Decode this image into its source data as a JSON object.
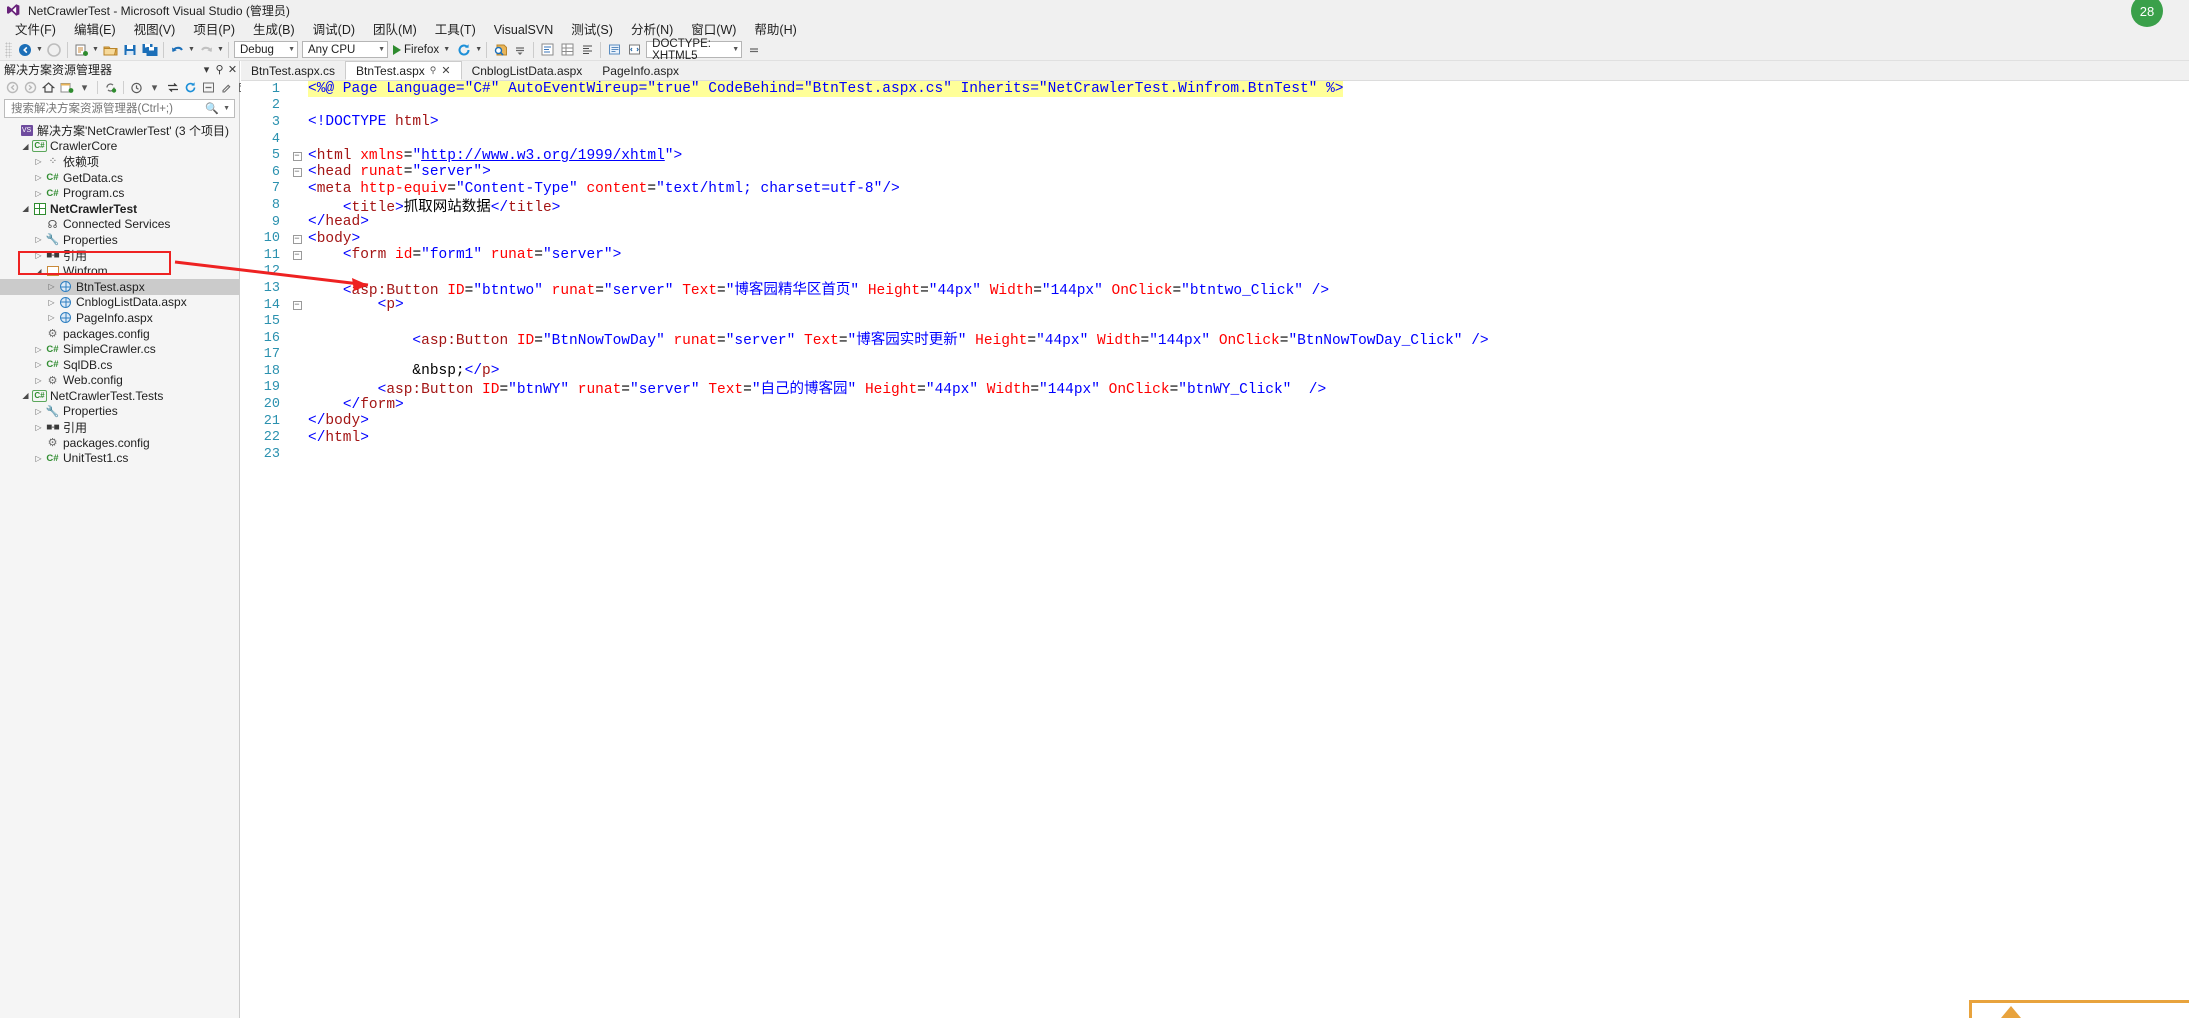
{
  "window": {
    "title": "NetCrawlerTest - Microsoft Visual Studio (管理员)",
    "logo_icon": "visual-studio-logo-icon"
  },
  "menubar": {
    "items": [
      {
        "label": "文件(F)"
      },
      {
        "label": "编辑(E)"
      },
      {
        "label": "视图(V)"
      },
      {
        "label": "项目(P)"
      },
      {
        "label": "生成(B)"
      },
      {
        "label": "调试(D)"
      },
      {
        "label": "团队(M)"
      },
      {
        "label": "工具(T)"
      },
      {
        "label": "VisualSVN"
      },
      {
        "label": "测试(S)"
      },
      {
        "label": "分析(N)"
      },
      {
        "label": "窗口(W)"
      },
      {
        "label": "帮助(H)"
      }
    ]
  },
  "toolbar": {
    "back_icon": "navigate-back-icon",
    "forward_icon": "navigate-forward-icon",
    "newproject_icon": "new-project-icon",
    "openfile_icon": "open-file-icon",
    "save_icon": "save-icon",
    "saveall_icon": "save-all-icon",
    "undo_icon": "undo-icon",
    "redo_icon": "redo-icon",
    "config_value": "Debug",
    "platform_value": "Any CPU",
    "run_label": "Firefox",
    "run_icon": "start-debug-play-icon",
    "refresh_icon": "refresh-icon",
    "find_icon": "find-in-files-icon",
    "overflow_icon": "toolbar-overflow-icon",
    "doctype_value": "DOCTYPE: XHTML5"
  },
  "solution_explorer": {
    "title": "解决方案资源管理器",
    "pin_icon": "pin-icon",
    "close_icon": "close-icon",
    "toolbar_icons": [
      "back-icon",
      "forward-icon",
      "home-icon",
      "pending-changes-icon",
      "dropdown-caret-icon",
      "sync-with-active-document-icon",
      "history-icon",
      "show-all-files-icon",
      "refresh-icon",
      "collapse-all-icon",
      "properties-icon",
      "preview-selected-items-icon"
    ],
    "search_placeholder": "搜索解决方案资源管理器(Ctrl+;)",
    "search_value": "",
    "search_icon": "search-icon",
    "search_caret_icon": "chevron-down-icon",
    "tree": [
      {
        "depth": 0,
        "twisty": "none",
        "icon": "solution-icon",
        "label": "解决方案'NetCrawlerTest' (3 个项目)",
        "bold": false,
        "selected": false
      },
      {
        "depth": 1,
        "twisty": "open",
        "icon": "csharp-project-icon",
        "label": "CrawlerCore",
        "bold": false,
        "selected": false
      },
      {
        "depth": 2,
        "twisty": "closed",
        "icon": "dependencies-icon",
        "label": "依赖项",
        "bold": false,
        "selected": false
      },
      {
        "depth": 2,
        "twisty": "closed",
        "icon": "csharp-file-icon",
        "label": "GetData.cs",
        "bold": false,
        "selected": false
      },
      {
        "depth": 2,
        "twisty": "closed",
        "icon": "csharp-file-icon",
        "label": "Program.cs",
        "bold": false,
        "selected": false
      },
      {
        "depth": 1,
        "twisty": "open",
        "icon": "web-project-icon",
        "label": "NetCrawlerTest",
        "bold": true,
        "selected": false
      },
      {
        "depth": 2,
        "twisty": "none",
        "icon": "connected-services-icon",
        "label": "Connected Services",
        "bold": false,
        "selected": false
      },
      {
        "depth": 2,
        "twisty": "closed",
        "icon": "properties-icon",
        "label": "Properties",
        "bold": false,
        "selected": false
      },
      {
        "depth": 2,
        "twisty": "closed",
        "icon": "references-icon",
        "label": "引用",
        "bold": false,
        "selected": false
      },
      {
        "depth": 2,
        "twisty": "open",
        "icon": "folder-icon",
        "label": "Winfrom",
        "bold": false,
        "selected": false
      },
      {
        "depth": 3,
        "twisty": "closed",
        "icon": "aspx-page-icon",
        "label": "BtnTest.aspx",
        "bold": false,
        "selected": true
      },
      {
        "depth": 3,
        "twisty": "closed",
        "icon": "aspx-page-icon",
        "label": "CnblogListData.aspx",
        "bold": false,
        "selected": false
      },
      {
        "depth": 3,
        "twisty": "closed",
        "icon": "aspx-page-icon",
        "label": "PageInfo.aspx",
        "bold": false,
        "selected": false
      },
      {
        "depth": 2,
        "twisty": "none",
        "icon": "config-file-icon",
        "label": "packages.config",
        "bold": false,
        "selected": false
      },
      {
        "depth": 2,
        "twisty": "closed",
        "icon": "csharp-file-icon",
        "label": "SimpleCrawler.cs",
        "bold": false,
        "selected": false
      },
      {
        "depth": 2,
        "twisty": "closed",
        "icon": "csharp-file-icon",
        "label": "SqlDB.cs",
        "bold": false,
        "selected": false
      },
      {
        "depth": 2,
        "twisty": "closed",
        "icon": "config-file-icon",
        "label": "Web.config",
        "bold": false,
        "selected": false
      },
      {
        "depth": 1,
        "twisty": "open",
        "icon": "csharp-project-icon",
        "label": "NetCrawlerTest.Tests",
        "bold": false,
        "selected": false
      },
      {
        "depth": 2,
        "twisty": "closed",
        "icon": "properties-icon",
        "label": "Properties",
        "bold": false,
        "selected": false
      },
      {
        "depth": 2,
        "twisty": "closed",
        "icon": "references-icon",
        "label": "引用",
        "bold": false,
        "selected": false
      },
      {
        "depth": 2,
        "twisty": "none",
        "icon": "config-file-icon",
        "label": "packages.config",
        "bold": false,
        "selected": false
      },
      {
        "depth": 2,
        "twisty": "closed",
        "icon": "csharp-file-icon",
        "label": "UnitTest1.cs",
        "bold": false,
        "selected": false
      }
    ]
  },
  "editor": {
    "tabs": [
      {
        "label": "BtnTest.aspx.cs",
        "active": false,
        "pinned": false,
        "closable": false
      },
      {
        "label": "BtnTest.aspx",
        "active": true,
        "pinned": true,
        "closable": true
      },
      {
        "label": "CnblogListData.aspx",
        "active": false,
        "pinned": false,
        "closable": false
      },
      {
        "label": "PageInfo.aspx",
        "active": false,
        "pinned": false,
        "closable": false
      }
    ],
    "tab_pin_icon": "pin-icon",
    "tab_close_icon": "close-icon",
    "code_lines": [
      {
        "n": 1,
        "fold": "",
        "cursor": false,
        "text": "<%@ Page Language=\"C#\" AutoEventWireup=\"true\" CodeBehind=\"BtnTest.aspx.cs\" Inherits=\"NetCrawlerTest.Winfrom.BtnTest\" %>"
      },
      {
        "n": 2,
        "fold": "",
        "cursor": false,
        "text": ""
      },
      {
        "n": 3,
        "fold": "",
        "cursor": false,
        "text": "<!DOCTYPE html>"
      },
      {
        "n": 4,
        "fold": "",
        "cursor": false,
        "text": ""
      },
      {
        "n": 5,
        "fold": "-",
        "cursor": false,
        "text": "<html xmlns=\"http://www.w3.org/1999/xhtml\">"
      },
      {
        "n": 6,
        "fold": "-",
        "cursor": false,
        "text": "<head runat=\"server\">"
      },
      {
        "n": 7,
        "fold": "",
        "cursor": false,
        "text": "<meta http-equiv=\"Content-Type\" content=\"text/html; charset=utf-8\"/>"
      },
      {
        "n": 8,
        "fold": "",
        "cursor": false,
        "text": "    <title>抓取网站数据</title>"
      },
      {
        "n": 9,
        "fold": "",
        "cursor": false,
        "text": "</head>"
      },
      {
        "n": 10,
        "fold": "-",
        "cursor": false,
        "text": "<body>"
      },
      {
        "n": 11,
        "fold": "-",
        "cursor": false,
        "text": "    <form id=\"form1\" runat=\"server\">"
      },
      {
        "n": 12,
        "fold": "",
        "cursor": false,
        "text": ""
      },
      {
        "n": 13,
        "fold": "",
        "cursor": true,
        "text": "    <asp:Button ID=\"btntwo\" runat=\"server\" Text=\"博客园精华区首页\" Height=\"44px\" Width=\"144px\" OnClick=\"btntwo_Click\" />"
      },
      {
        "n": 14,
        "fold": "-",
        "cursor": false,
        "text": "        <p>"
      },
      {
        "n": 15,
        "fold": "",
        "cursor": false,
        "text": ""
      },
      {
        "n": 16,
        "fold": "",
        "cursor": false,
        "text": "            <asp:Button ID=\"BtnNowTowDay\" runat=\"server\" Text=\"博客园实时更新\" Height=\"44px\" Width=\"144px\" OnClick=\"BtnNowTowDay_Click\" />"
      },
      {
        "n": 17,
        "fold": "",
        "cursor": false,
        "text": ""
      },
      {
        "n": 18,
        "fold": "",
        "cursor": false,
        "text": "            &nbsp;</p>"
      },
      {
        "n": 19,
        "fold": "",
        "cursor": false,
        "text": "        <asp:Button ID=\"btnWY\" runat=\"server\" Text=\"自己的博客园\" Height=\"44px\" Width=\"144px\" OnClick=\"btnWY_Click\"  />"
      },
      {
        "n": 20,
        "fold": "",
        "cursor": false,
        "text": "    </form>"
      },
      {
        "n": 21,
        "fold": "",
        "cursor": false,
        "text": "</body>"
      },
      {
        "n": 22,
        "fold": "",
        "cursor": false,
        "text": "</html>"
      },
      {
        "n": 23,
        "fold": "",
        "cursor": false,
        "text": ""
      }
    ]
  },
  "annotations": {
    "highlight_box_name": "btntest-aspx-highlight-box",
    "arrow_name": "callout-arrow",
    "color": "#ee2222"
  },
  "notification": {
    "count": "28",
    "color": "#3aa04a"
  }
}
